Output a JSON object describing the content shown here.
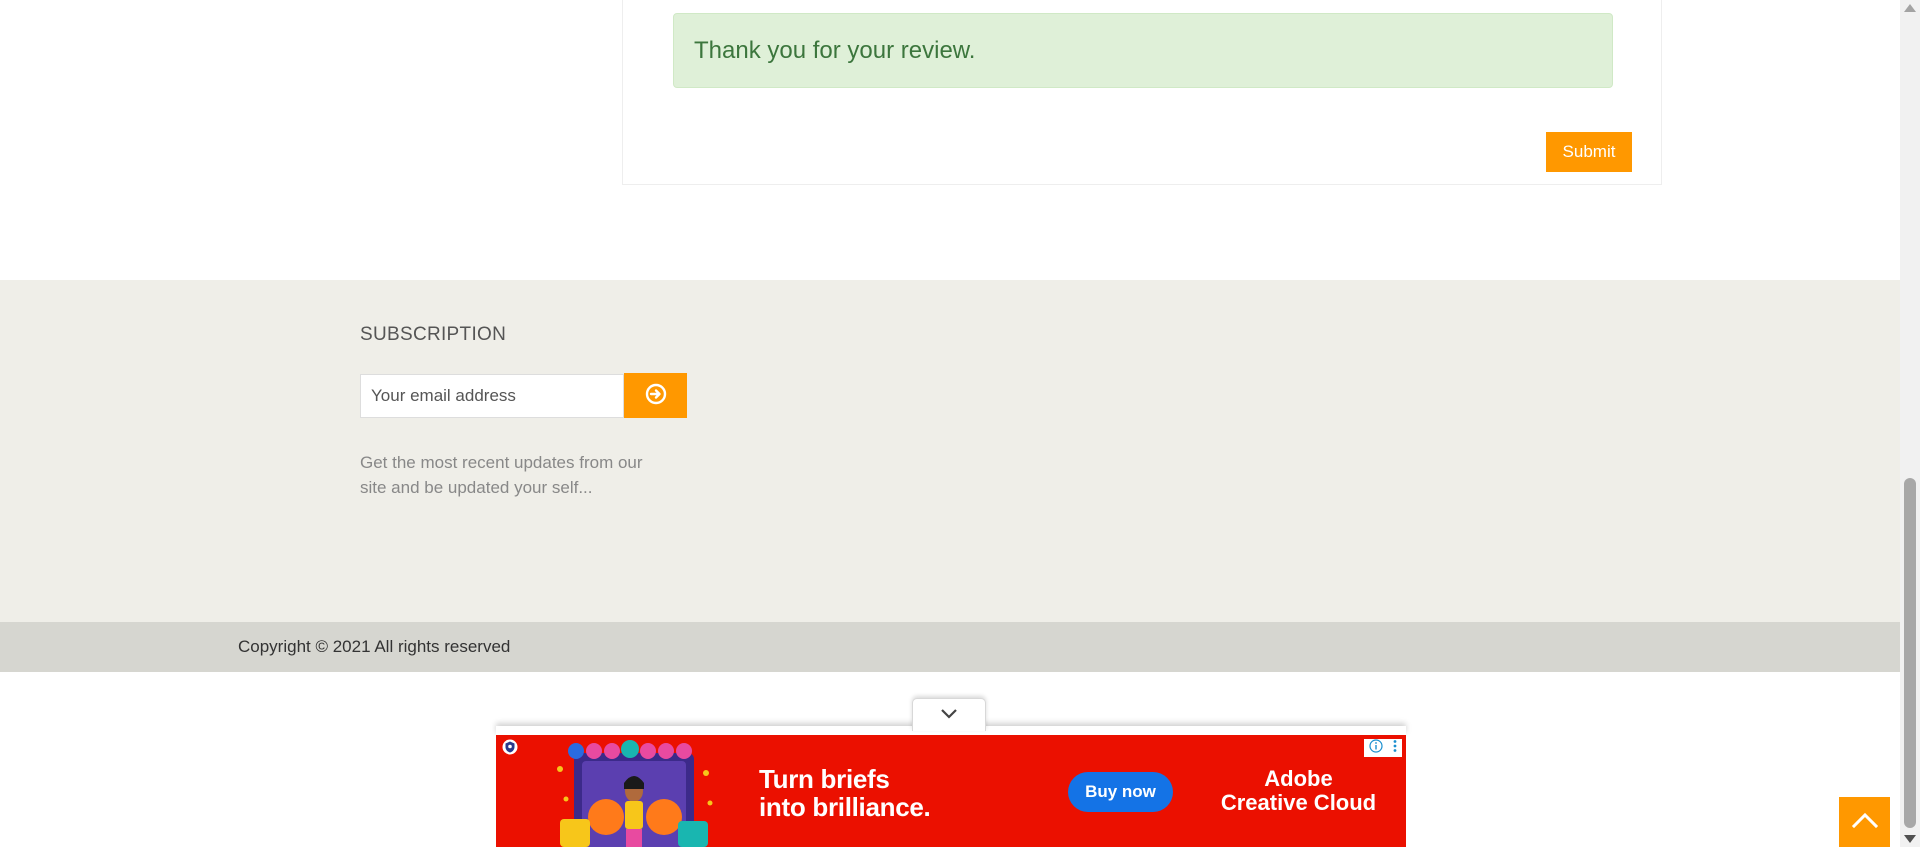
{
  "review": {
    "success_message": "Thank you for your review.",
    "submit_label": "Submit"
  },
  "subscription": {
    "title": "SUBSCRIPTION",
    "email_placeholder": "Your email address",
    "description": "Get the most recent updates from our site and be updated your self..."
  },
  "footer": {
    "copyright": "Copyright © 2021 All rights reserved"
  },
  "ad": {
    "headline_line1": "Turn briefs",
    "headline_line2": "into brilliance.",
    "cta_label": "Buy now",
    "brand_line1": "Adobe",
    "brand_line2": "Creative Cloud"
  },
  "colors": {
    "accent": "#ff9800",
    "success_bg": "#dff0d8",
    "success_text": "#3c763d",
    "footer_bg": "#efeee8",
    "copyright_bg": "#d6d6d0",
    "ad_bg": "#eb1000",
    "ad_cta": "#1473e6"
  },
  "icons": {
    "subscribe": "arrow-circle-right-icon",
    "back_to_top": "chevron-up-icon",
    "ad_toggle": "chevron-down-icon",
    "ad_info": "info-icon",
    "ad_menu": "more-vertical-icon",
    "ad_shield": "shield-icon"
  }
}
